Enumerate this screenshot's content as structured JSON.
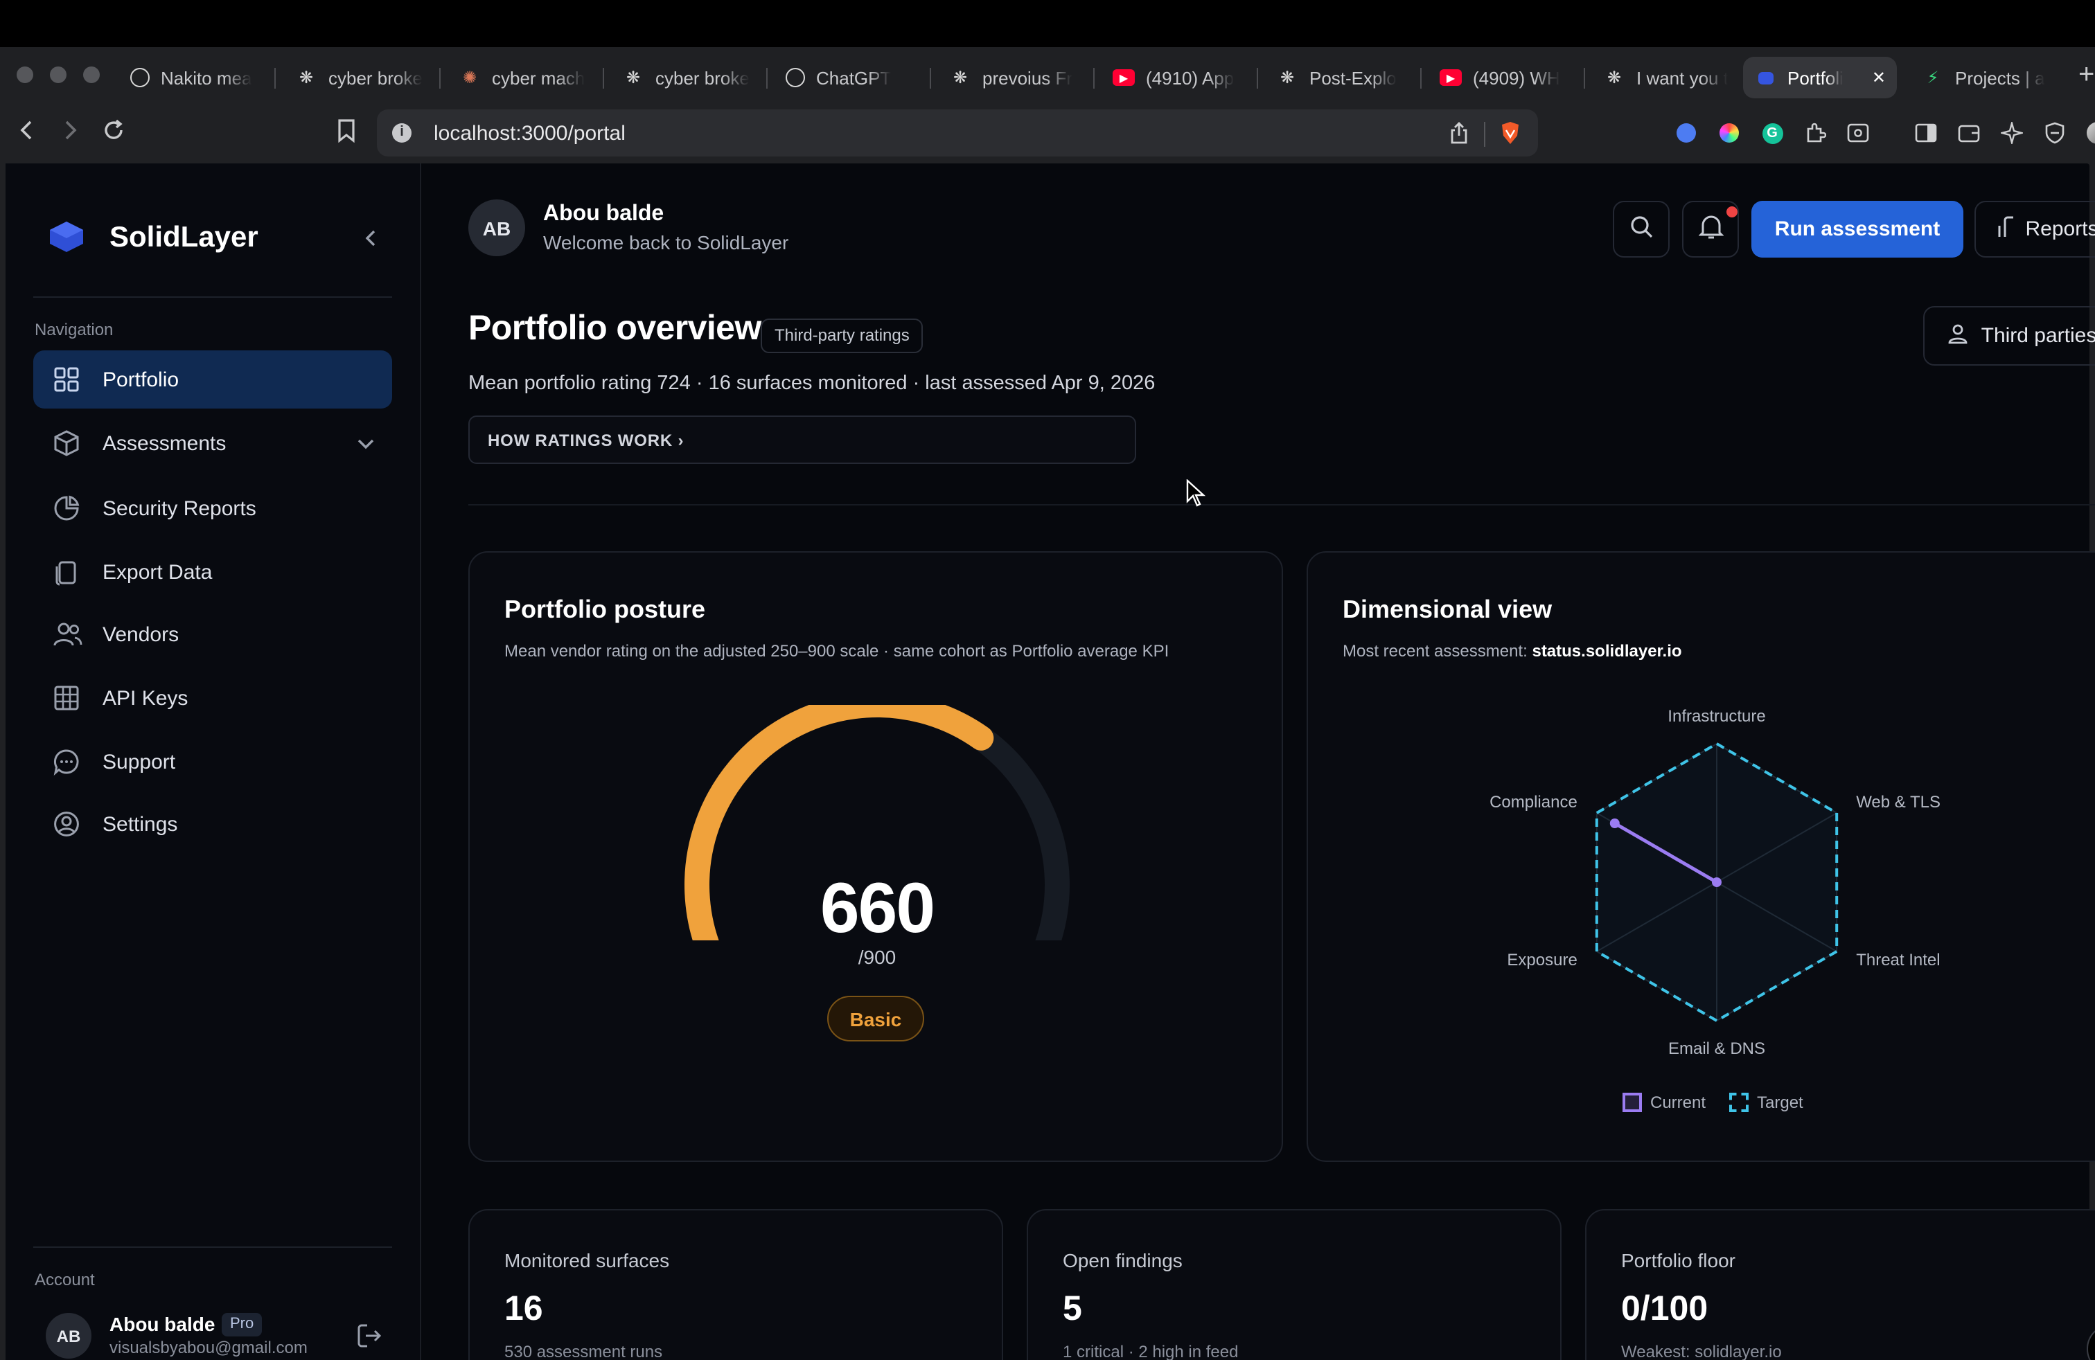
{
  "browser": {
    "tabs": [
      {
        "title": "Nakito mea",
        "icon": "chatgpt-icon"
      },
      {
        "title": "cyber broke",
        "icon": "openai-icon"
      },
      {
        "title": "cyber mach",
        "icon": "claude-icon"
      },
      {
        "title": "cyber broke",
        "icon": "openai-icon"
      },
      {
        "title": "ChatGPT",
        "icon": "chatgpt-icon"
      },
      {
        "title": "prevoius Fr",
        "icon": "openai-icon"
      },
      {
        "title": "(4910) App",
        "icon": "youtube-icon"
      },
      {
        "title": "Post-Explo",
        "icon": "openai-icon"
      },
      {
        "title": "(4909) WH",
        "icon": "youtube-icon"
      },
      {
        "title": "I want you t",
        "icon": "openai-icon"
      },
      {
        "title": "Portfoli",
        "icon": "solidlayer-icon"
      },
      {
        "title": "Projects | a",
        "icon": "bolt-icon"
      }
    ],
    "url": "localhost:3000/portal"
  },
  "sidebar": {
    "brand": "SolidLayer",
    "nav_heading": "Navigation",
    "items": [
      {
        "label": "Portfolio"
      },
      {
        "label": "Assessments"
      },
      {
        "label": "Security Reports"
      },
      {
        "label": "Export Data"
      },
      {
        "label": "Vendors"
      },
      {
        "label": "API Keys"
      },
      {
        "label": "Support"
      },
      {
        "label": "Settings"
      }
    ],
    "account_heading": "Account",
    "account": {
      "initials": "AB",
      "name": "Abou balde",
      "plan": "Pro",
      "email": "visualsbyabou@gmail.com"
    }
  },
  "header": {
    "initials": "AB",
    "name": "Abou balde",
    "welcome": "Welcome back to SolidLayer",
    "run_label": "Run assessment",
    "reports_label": "Reports"
  },
  "overview": {
    "title": "Portfolio overview",
    "badge": "Third-party ratings",
    "summary": "Mean portfolio rating 724 · 16 surfaces monitored · last assessed Apr 9, 2026",
    "how_ratings": "HOW RATINGS WORK ›",
    "third_parties_label": "Third parties"
  },
  "posture": {
    "title": "Portfolio posture",
    "subtitle": "Mean vendor rating on the adjusted 250–900 scale · same cohort as Portfolio average KPI",
    "score": "660",
    "max": "/900",
    "score_value": 660,
    "scale_min": 250,
    "scale_max": 900,
    "tier": "Basic",
    "color": "#f0a23c"
  },
  "dimensional": {
    "title": "Dimensional view",
    "subtitle_prefix": "Most recent assessment:",
    "subtitle_host": "status.solidlayer.io",
    "axes": [
      "Infrastructure",
      "Web & TLS",
      "Threat Intel",
      "Email & DNS",
      "Exposure",
      "Compliance"
    ],
    "current": [
      0,
      0,
      0,
      0,
      0,
      0.85
    ],
    "target": [
      1,
      1,
      1,
      1,
      1,
      1
    ],
    "legend_current": "Current",
    "legend_target": "Target",
    "current_color": "#9b7cf2",
    "target_color": "#3fc4e8"
  },
  "stats": [
    {
      "title": "Monitored surfaces",
      "value": "16",
      "sub": "530 assessment runs"
    },
    {
      "title": "Open findings",
      "value": "5",
      "sub": "1 critical · 2 high in feed"
    },
    {
      "title": "Portfolio floor",
      "value": "0/100",
      "sub": "Weakest: solidlayer.io"
    }
  ],
  "colors": {
    "primary": "#2563d8",
    "active_nav": "#102a52",
    "bg": "#06080d"
  }
}
